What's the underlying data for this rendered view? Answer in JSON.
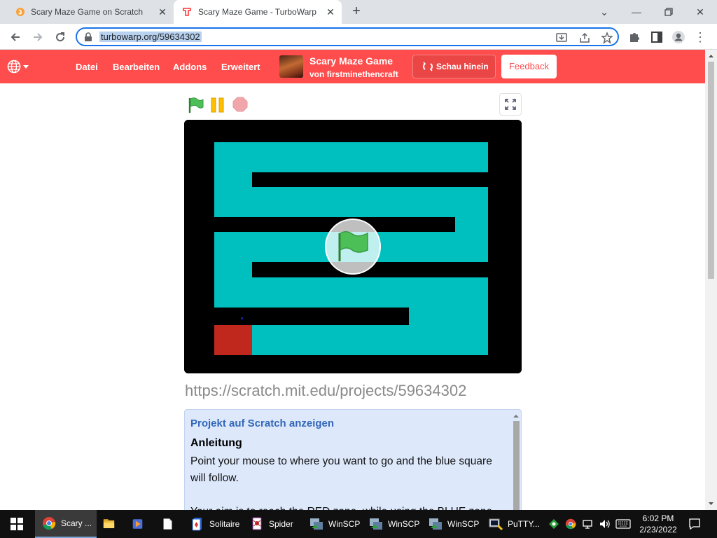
{
  "browser": {
    "tabs": [
      {
        "title": "Scary Maze Game on Scratch",
        "active": false
      },
      {
        "title": "Scary Maze Game - TurboWarp",
        "active": true
      }
    ],
    "address": {
      "url": "turbowarp.org/59634302"
    }
  },
  "turbowarp": {
    "menu": [
      "Datei",
      "Bearbeiten",
      "Addons",
      "Erweitert"
    ],
    "project_title": "Scary Maze Game",
    "project_author": "von firstminethencraft",
    "see_inside_label": "Schau hinein",
    "feedback_label": "Feedback",
    "colors": {
      "brand": "#ff4c4c",
      "stage_bg": "#000000",
      "maze": "#00bfbf",
      "goal_zone": "#c0281e"
    }
  },
  "player": {
    "scratch_url": "https://scratch.mit.edu/projects/59634302"
  },
  "description": {
    "view_on_scratch": "Projekt auf Scratch anzeigen",
    "heading": "Anleitung",
    "paragraph1": "Point your mouse to where you want to go and the blue square will follow.",
    "paragraph2": "Your aim is to reach the RED zone, while using the BLUE zone"
  },
  "taskbar": {
    "apps": [
      {
        "label": "Scary ...",
        "icon": "chrome-icon"
      },
      {
        "label": "",
        "icon": "file-explorer-icon"
      },
      {
        "label": "",
        "icon": "media-player-icon"
      },
      {
        "label": "",
        "icon": "document-icon"
      },
      {
        "label": "Solitaire",
        "icon": "solitaire-icon"
      },
      {
        "label": "Spider",
        "icon": "spider-solitaire-icon"
      },
      {
        "label": "WinSCP",
        "icon": "winscp-icon"
      },
      {
        "label": "WinSCP",
        "icon": "winscp-icon"
      },
      {
        "label": "WinSCP",
        "icon": "winscp-icon"
      },
      {
        "label": "PuTTY...",
        "icon": "putty-icon"
      }
    ],
    "time": "6:02 PM",
    "date": "2/23/2022"
  }
}
